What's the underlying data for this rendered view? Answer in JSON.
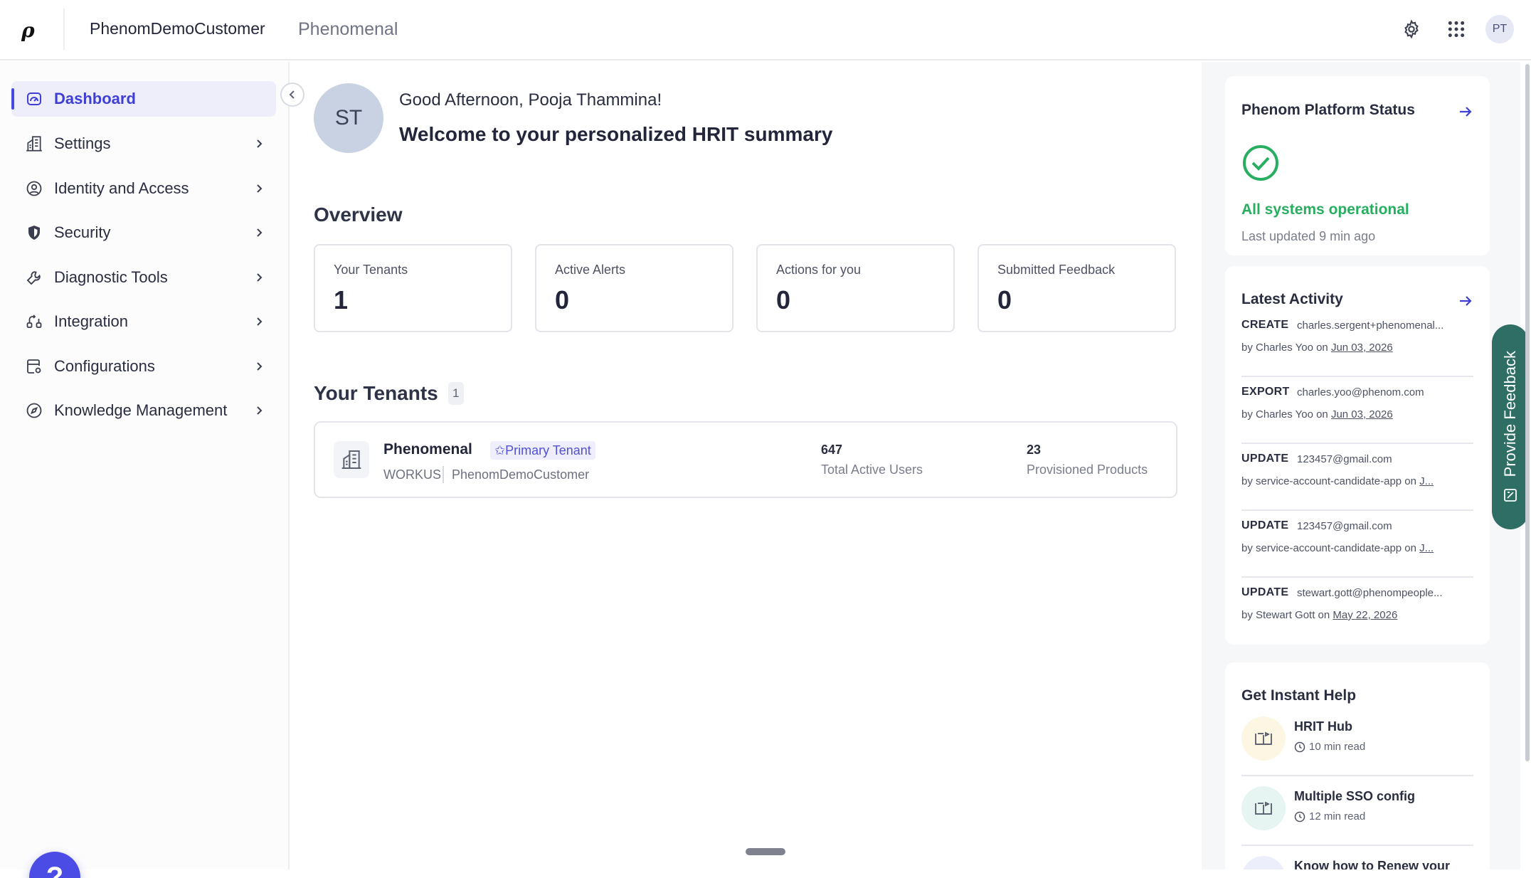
{
  "topbar": {
    "logo": "ρ",
    "org_name": "PhenomDemoCustomer",
    "org_sub": "Phenomenal",
    "user_initials": "PT"
  },
  "sidebar": {
    "items": [
      {
        "label": "Dashboard",
        "icon": "gauge-icon"
      },
      {
        "label": "Settings",
        "icon": "building-icon"
      },
      {
        "label": "Identity and Access",
        "icon": "user-circle-icon"
      },
      {
        "label": "Security",
        "icon": "shield-icon"
      },
      {
        "label": "Diagnostic Tools",
        "icon": "wrench-icon"
      },
      {
        "label": "Integration",
        "icon": "integration-icon"
      },
      {
        "label": "Configurations",
        "icon": "config-icon"
      },
      {
        "label": "Knowledge Management",
        "icon": "compass-icon"
      }
    ],
    "help_label": "?"
  },
  "greeting": {
    "avatar": "ST",
    "line": "Good Afternoon, Pooja Thammina!",
    "welcome": "Welcome to your personalized HRIT summary"
  },
  "overview": {
    "title": "Overview",
    "cards": [
      {
        "label": "Your Tenants",
        "value": "1"
      },
      {
        "label": "Active Alerts",
        "value": "0"
      },
      {
        "label": "Actions for you",
        "value": "0"
      },
      {
        "label": "Submitted Feedback",
        "value": "0"
      }
    ]
  },
  "tenants": {
    "title": "Your Tenants",
    "count": "1",
    "items": [
      {
        "name": "Phenomenal",
        "badge": "✩Primary Tenant",
        "region": "WORKUS",
        "org": "PhenomDemoCustomer",
        "users_value": "647",
        "users_label": "Total Active Users",
        "products_value": "23",
        "products_label": "Provisioned Products"
      }
    ]
  },
  "platform_status": {
    "title": "Phenom Platform Status",
    "status": "All systems operational",
    "updated": "Last updated 9 min ago",
    "ok_color": "#27ae60"
  },
  "latest_activity": {
    "title": "Latest Activity",
    "items": [
      {
        "action": "CREATE",
        "target": "charles.sergent+phenomenal...",
        "by": "by Charles Yoo on ",
        "date": "Jun 03, 2026"
      },
      {
        "action": "EXPORT",
        "target": "charles.yoo@phenom.com",
        "by": "by Charles Yoo on ",
        "date": "Jun 03, 2026"
      },
      {
        "action": "UPDATE",
        "target": "123457@gmail.com",
        "by": "by service-account-candidate-app on ",
        "date": "J..."
      },
      {
        "action": "UPDATE",
        "target": "123457@gmail.com",
        "by": "by service-account-candidate-app on ",
        "date": "J..."
      },
      {
        "action": "UPDATE",
        "target": "stewart.gott@phenompeople...",
        "by": "by Stewart Gott on ",
        "date": "May 22, 2026"
      }
    ]
  },
  "instant_help": {
    "title": "Get Instant Help",
    "items": [
      {
        "title": "HRIT Hub",
        "read": "10 min read",
        "bg": "#fdf6e3"
      },
      {
        "title": "Multiple SSO config",
        "read": "12 min read",
        "bg": "#e6f5f1"
      },
      {
        "title": "Know how to Renew your",
        "read": "",
        "bg": "#eceefb"
      }
    ]
  },
  "feedback": {
    "label": "Provide Feedback",
    "color": "#2f6e64"
  },
  "colors": {
    "accent": "#4b4ae0",
    "active_bg": "#eeeefb"
  }
}
